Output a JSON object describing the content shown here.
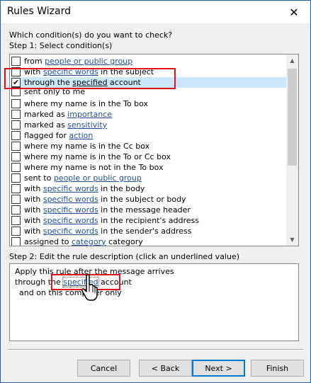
{
  "window": {
    "title": "Rules Wizard"
  },
  "question": "Which condition(s) do you want to check?",
  "step1_label": "Step 1: Select condition(s)",
  "conditions": [
    {
      "pre": "from ",
      "link": "people or public group",
      "post": "",
      "checked": false
    },
    {
      "pre": "with ",
      "link": "specific words",
      "post": " in the subject",
      "checked": false
    },
    {
      "pre": "through the ",
      "link": "specified",
      "post": " account",
      "checked": true
    },
    {
      "pre": "sent only to me",
      "link": "",
      "post": "",
      "checked": false
    },
    {
      "pre": "where my name is in the To box",
      "link": "",
      "post": "",
      "checked": false
    },
    {
      "pre": "marked as ",
      "link": "importance",
      "post": "",
      "checked": false
    },
    {
      "pre": "marked as ",
      "link": "sensitivity",
      "post": "",
      "checked": false
    },
    {
      "pre": "flagged for ",
      "link": "action",
      "post": "",
      "checked": false
    },
    {
      "pre": "where my name is in the Cc box",
      "link": "",
      "post": "",
      "checked": false
    },
    {
      "pre": "where my name is in the To or Cc box",
      "link": "",
      "post": "",
      "checked": false
    },
    {
      "pre": "where my name is not in the To box",
      "link": "",
      "post": "",
      "checked": false
    },
    {
      "pre": "sent to ",
      "link": "people or public group",
      "post": "",
      "checked": false
    },
    {
      "pre": "with ",
      "link": "specific words",
      "post": " in the body",
      "checked": false
    },
    {
      "pre": "with ",
      "link": "specific words",
      "post": " in the subject or body",
      "checked": false
    },
    {
      "pre": "with ",
      "link": "specific words",
      "post": " in the message header",
      "checked": false
    },
    {
      "pre": "with ",
      "link": "specific words",
      "post": " in the recipient's address",
      "checked": false
    },
    {
      "pre": "with ",
      "link": "specific words",
      "post": " in the sender's address",
      "checked": false
    },
    {
      "pre": "assigned to ",
      "link": "category",
      "post": " category",
      "checked": false
    }
  ],
  "step2_label": "Step 2: Edit the rule description (click an underlined value)",
  "description": {
    "line1": "Apply this rule after the message arrives",
    "line2_pre": "through the ",
    "line2_link": "specified",
    "line2_post": " account",
    "line3": "and on this computer only"
  },
  "buttons": {
    "cancel": "Cancel",
    "back": "< Back",
    "next": "Next >",
    "finish": "Finish"
  },
  "icons": {
    "close": "close-icon",
    "check": "checkmark-icon",
    "scroll_up": "scroll-up-icon",
    "scroll_down": "scroll-down-icon",
    "cursor": "hand-pointer-icon"
  },
  "colors": {
    "link": "#1f4e9e",
    "highlight": "#e0111b",
    "selected_row": "#cce8ff"
  }
}
